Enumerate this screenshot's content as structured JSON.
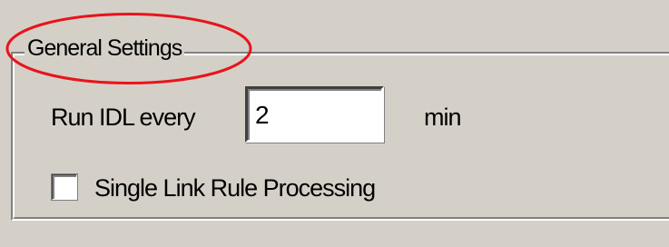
{
  "general_settings": {
    "title": "General Settings",
    "run_idl": {
      "label": "Run IDL every",
      "value": "2",
      "unit": "min"
    },
    "single_link": {
      "label": "Single Link Rule Processing",
      "checked": false
    }
  },
  "colors": {
    "background": "#d4d0c8",
    "highlight_annotation": "#e8141c"
  }
}
